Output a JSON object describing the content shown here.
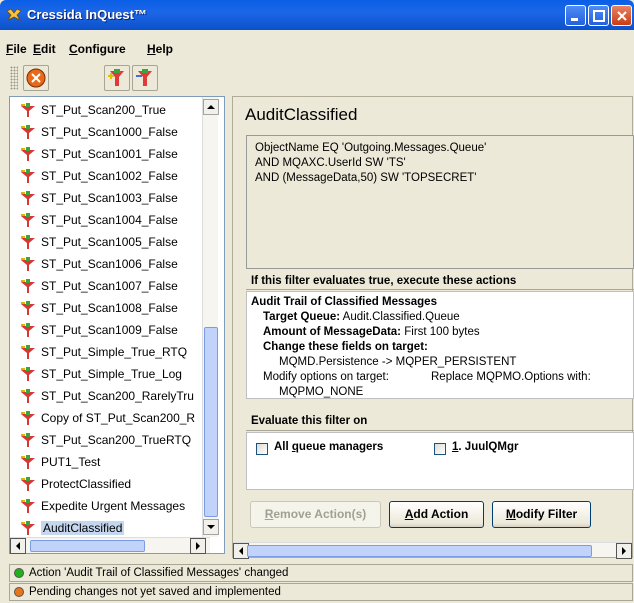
{
  "window": {
    "title": "Cressida InQuest™"
  },
  "menu": [
    {
      "key": "F",
      "rest": "ile"
    },
    {
      "key": "E",
      "rest": "dit"
    },
    {
      "key": "C",
      "rest": "onfigure"
    },
    {
      "key": "H",
      "rest": "elp"
    }
  ],
  "filters": [
    "ST_Put_Scan200_True",
    "ST_Put_Scan1000_False",
    "ST_Put_Scan1001_False",
    "ST_Put_Scan1002_False",
    "ST_Put_Scan1003_False",
    "ST_Put_Scan1004_False",
    "ST_Put_Scan1005_False",
    "ST_Put_Scan1006_False",
    "ST_Put_Scan1007_False",
    "ST_Put_Scan1008_False",
    "ST_Put_Scan1009_False",
    "ST_Put_Simple_True_RTQ",
    "ST_Put_Simple_True_Log",
    "ST_Put_Scan200_RarelyTru",
    "Copy of ST_Put_Scan200_R",
    "ST_Put_Scan200_TrueRTQ",
    "PUT1_Test",
    "ProtectClassified",
    "Expedite Urgent Messages",
    "AuditClassified"
  ],
  "selected_filter": "AuditClassified",
  "detail": {
    "title": "AuditClassified",
    "filter_lines": [
      "ObjectName EQ 'Outgoing.Messages.Queue'",
      "AND MQAXC.UserId SW 'TS'",
      "AND (MessageData,50) SW 'TOPSECRET'"
    ],
    "actions_header": "If this filter evaluates true, execute these actions",
    "action_name": "Audit Trail of Classified Messages",
    "target_queue_label": "Target Queue:",
    "target_queue_value": "Audit.Classified.Queue",
    "amount_label": "Amount of MessageData:",
    "amount_value": "First 100 bytes",
    "change_fields_label": "Change these fields on target:",
    "change_fields_value": "MQMD.Persistence -> MQPER_PERSISTENT",
    "modify_options_label": "Modify options on target:",
    "modify_options_replace": "Replace MQPMO.Options with:",
    "modify_options_value": "MQPMO_NONE",
    "evaluate_header": "Evaluate this filter on",
    "all_qm_pre": "All ",
    "all_qm_key": "q",
    "all_qm_post": "ueue managers",
    "qm_key": "1",
    "qm_rest": ". JuulQMgr"
  },
  "buttons": {
    "remove_key": "R",
    "remove_rest": "emove Action(s)",
    "add_key": "A",
    "add_rest": "dd Action",
    "modify_key": "M",
    "modify_rest": "odify Filter"
  },
  "status": [
    {
      "text": "Action 'Audit Trail of Classified Messages' changed",
      "color": "#21b021"
    },
    {
      "text": "Pending changes not yet saved and implemented",
      "color": "#e8751a"
    }
  ]
}
